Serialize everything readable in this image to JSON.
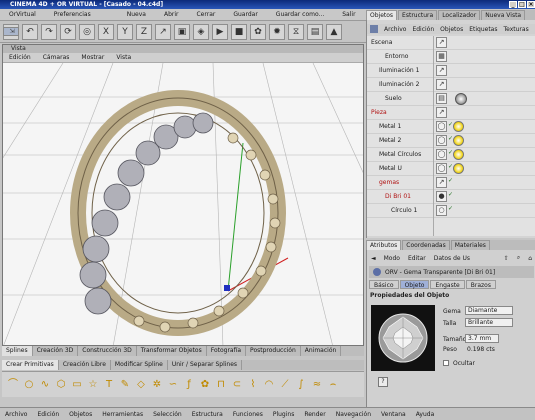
{
  "window": {
    "title": "CINEMA 4D + OR VIRTUAL - [Casado - 04.c4d]"
  },
  "main_menu": [
    "OrVirtual",
    "Preferencias",
    "Nueva",
    "Abrir",
    "Cerrar",
    "Guardar",
    "Guardar como...",
    "Salir"
  ],
  "viewport": {
    "title": "Vista",
    "menu": [
      "Edición",
      "Cámaras",
      "Mostrar",
      "Vista"
    ]
  },
  "mode_tabs": {
    "items": [
      "Splines",
      "Creación 3D",
      "Construcción 3D",
      "Transformar Objetos",
      "Fotografía",
      "Postproducción",
      "Animación"
    ],
    "active": "Splines"
  },
  "sub_tabs": {
    "items": [
      "Crear Primitivas",
      "Creación Libre",
      "Modificar Spline",
      "Unir / Separar Splines"
    ],
    "active": "Crear Primitivas"
  },
  "bottom_menu": [
    "Archivo",
    "Edición",
    "Objetos",
    "Herramientas",
    "Selección",
    "Estructura",
    "Funciones",
    "Plugins",
    "Render",
    "Navegación",
    "Ventana",
    "Ayuda"
  ],
  "right_tabs": {
    "items": [
      "Objetos",
      "Estructura",
      "Localizador",
      "Nueva Vista"
    ],
    "active": "Objetos"
  },
  "object_menu": [
    "Archivo",
    "Edición",
    "Objetos",
    "Etiquetas",
    "Texturas"
  ],
  "objects": [
    {
      "label": "Escena"
    },
    {
      "label": "Entorno"
    },
    {
      "label": "Iluminación 1"
    },
    {
      "label": "Iluminación 2"
    },
    {
      "label": "Suelo"
    },
    {
      "label": "Pieza"
    },
    {
      "label": "Metal 1"
    },
    {
      "label": "Metal 2"
    },
    {
      "label": "Metal Círculos"
    },
    {
      "label": "Metal U"
    },
    {
      "label": "gemas"
    },
    {
      "label": "Di Bri 01"
    },
    {
      "label": "Círculo 1"
    }
  ],
  "attr_tabs": {
    "items": [
      "Atributos",
      "Coordenadas",
      "Materiales"
    ],
    "active": "Atributos"
  },
  "attr_menu": [
    "Modo",
    "Editar",
    "Datos de Us"
  ],
  "attr_object": "ORV - Gema Transparente [Di Bri 01]",
  "attr_subtabs": {
    "items": [
      "Básico",
      "Objeto",
      "Engaste",
      "Brazos"
    ],
    "active": "Objeto"
  },
  "properties": {
    "title": "Propiedades del Objeto",
    "gema_label": "Gema",
    "gema_value": "Diamante",
    "talla_label": "Talla",
    "talla_value": "Brillante",
    "tamano_label": "Tamaño",
    "tamano_value": "3.7 mm",
    "peso_label": "Peso",
    "peso_value": "0.198 cts",
    "ocultar_label": "Ocultar"
  },
  "help_label": "?",
  "colors": {
    "accent": "#0c2a7a",
    "gem_yellow": "#f0d000",
    "selected_tab": "#9fb0d8"
  }
}
